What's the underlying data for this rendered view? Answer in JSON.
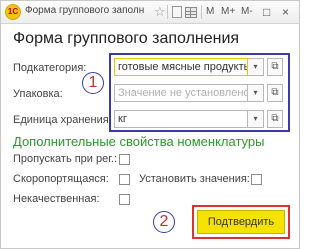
{
  "window": {
    "title": "Форма группового заполн",
    "logo_text": "1С",
    "toolbar": {
      "m_label": "M",
      "m_plus_label": "M+",
      "m_minus_label": "M-",
      "restore_label": "□",
      "close_label": "×",
      "star_label": "☆",
      "dd_arrow": "▾",
      "open_glyph": "⧉"
    }
  },
  "form": {
    "title": "Форма группового заполнения",
    "fields": [
      {
        "label": "Подкатегория:",
        "value": "готовые мясные продукты",
        "placeholder": ""
      },
      {
        "label": "Упаковка:",
        "value": "",
        "placeholder": "Значение не установлено"
      },
      {
        "label": "Единица хранения:",
        "value": "кг",
        "placeholder": ""
      }
    ],
    "section_title": "Дополнительные свойства номенклатуры",
    "checkboxes": {
      "skip_on_reg": {
        "label": "Пропускать при рег.:",
        "checked": false
      },
      "perishable": {
        "label": "Скоропортящаяся:",
        "checked": false
      },
      "set_value": {
        "label": "Установить значения:",
        "checked": false
      },
      "substandard": {
        "label": "Некачественная:",
        "checked": false
      }
    },
    "confirm_label": "Подтвердить"
  },
  "annotations": {
    "one": {
      "number": "1",
      "color": "#3a3aa8"
    },
    "two": {
      "number": "2",
      "color": "#e03030"
    }
  },
  "colors": {
    "section_title": "#2a9a2a",
    "confirm_button": "#f5e200",
    "field_highlight": "#e8c800"
  }
}
